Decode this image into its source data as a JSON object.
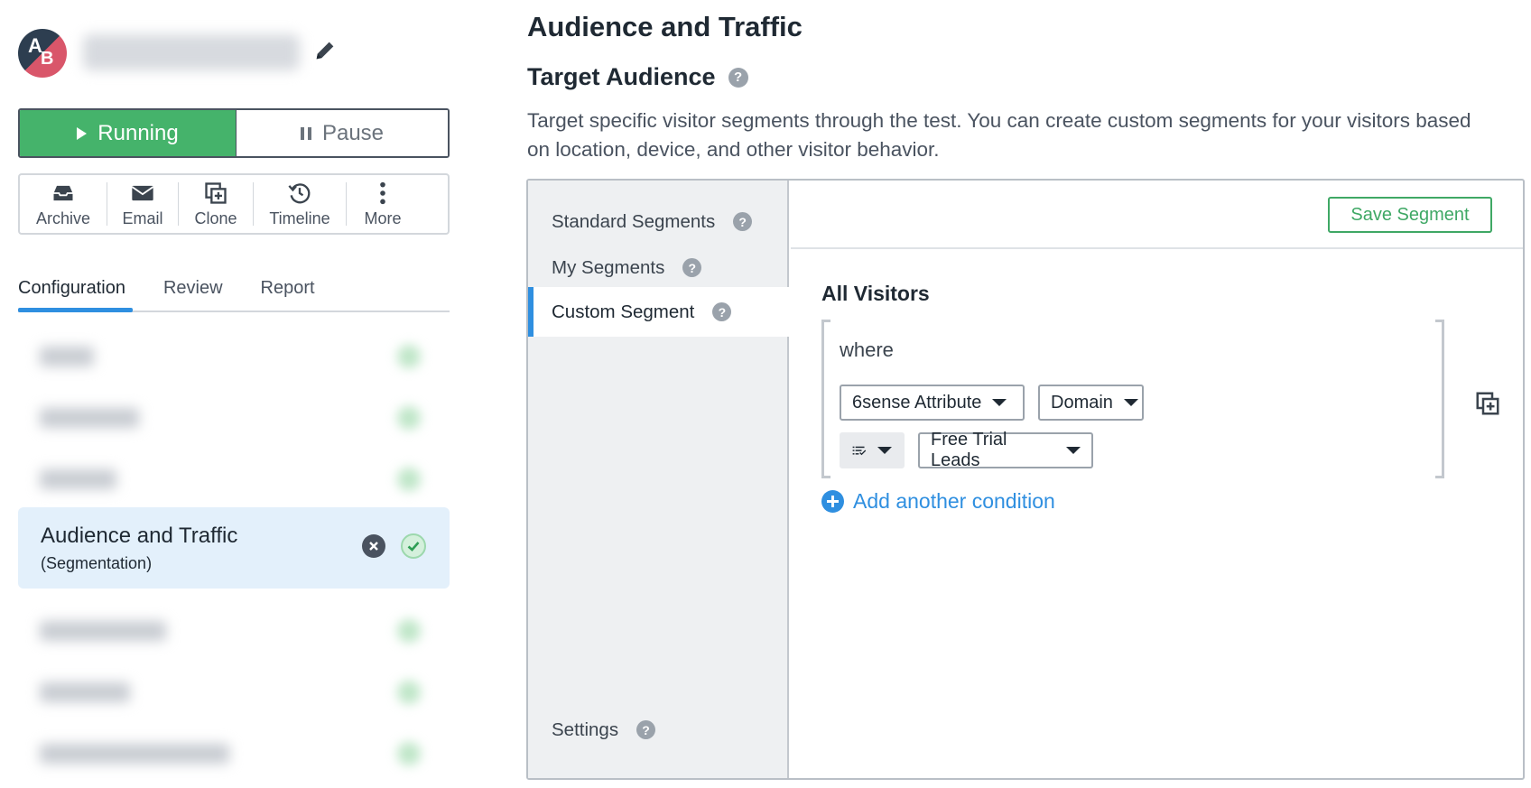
{
  "campaign": {
    "avatar_letters": [
      "A",
      "B"
    ]
  },
  "run_toggle": {
    "running_label": "Running",
    "pause_label": "Pause"
  },
  "actions": [
    {
      "label": "Archive",
      "icon": "archive-icon"
    },
    {
      "label": "Email",
      "icon": "email-icon"
    },
    {
      "label": "Clone",
      "icon": "clone-icon"
    },
    {
      "label": "Timeline",
      "icon": "history-icon"
    },
    {
      "label": "More",
      "icon": "more-vertical-icon"
    }
  ],
  "tabs": [
    {
      "label": "Configuration",
      "active": true
    },
    {
      "label": "Review",
      "active": false
    },
    {
      "label": "Report",
      "active": false
    }
  ],
  "sidebar": {
    "active_item": {
      "title": "Audience and Traffic",
      "subtitle": "(Segmentation)"
    }
  },
  "main": {
    "page_title": "Audience and Traffic",
    "section_title": "Target Audience",
    "description": "Target specific visitor segments through the test. You can create custom segments for your visitors based on location, device, and other visitor behavior.",
    "help_glyph": "?"
  },
  "segments_nav": {
    "items": [
      {
        "label": "Standard Segments",
        "active": false
      },
      {
        "label": "My Segments",
        "active": false
      },
      {
        "label": "Custom Segment",
        "active": true
      }
    ],
    "settings_label": "Settings"
  },
  "segment_editor": {
    "save_label": "Save Segment",
    "group_title": "All Visitors",
    "where_label": "where",
    "attribute_dropdown": "6sense Attribute",
    "field_dropdown": "Domain",
    "value_dropdown": "Free Trial Leads",
    "add_condition_label": "Add another condition"
  },
  "colors": {
    "accent_blue": "#2f8fe0",
    "running_green": "#45b36b",
    "active_item_bg": "#e3f0fb"
  }
}
